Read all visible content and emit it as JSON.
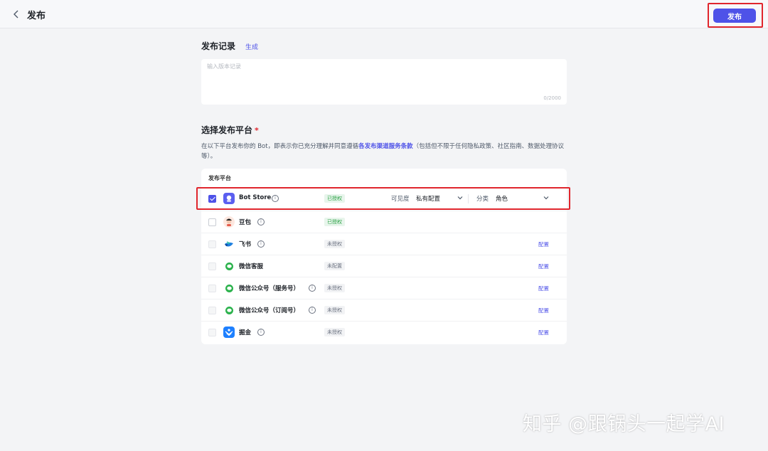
{
  "header": {
    "title": "发布",
    "publish_label": "发布"
  },
  "release_notes": {
    "title": "发布记录",
    "generate_label": "生成",
    "placeholder": "输入版本记录",
    "count": "0/2000"
  },
  "platforms": {
    "title": "选择发布平台",
    "required_mark": "*",
    "desc_prefix": "在以下平台发布你的 Bot，即表示你已充分理解并同意遵循",
    "desc_terms": "各发布渠道服务条款",
    "desc_suffix": "（包括但不限于任何隐私政策、社区指南、数据处理协议等）。",
    "column_header": "发布平台",
    "config_label": "配置",
    "visibility_label": "可见度",
    "visibility_value": "私有配置",
    "category_label": "分类",
    "category_value": "角色",
    "items": [
      {
        "name": "Bot Store",
        "status": "已授权",
        "checked": true
      },
      {
        "name": "豆包",
        "status": "已授权",
        "checked": false
      },
      {
        "name": "飞书",
        "status": "未授权",
        "checked": false
      },
      {
        "name": "微信客服",
        "status": "未配置",
        "checked": false
      },
      {
        "name": "微信公众号（服务号）",
        "status": "未授权",
        "checked": false
      },
      {
        "name": "微信公众号（订阅号）",
        "status": "未授权",
        "checked": false
      },
      {
        "name": "掘金",
        "status": "未授权",
        "checked": false
      }
    ]
  },
  "watermark": "知乎 @跟锅头一起学AI",
  "colors": {
    "accent": "#4e52e8",
    "highlight": "#e0262d",
    "authorized": "#2ba245"
  }
}
